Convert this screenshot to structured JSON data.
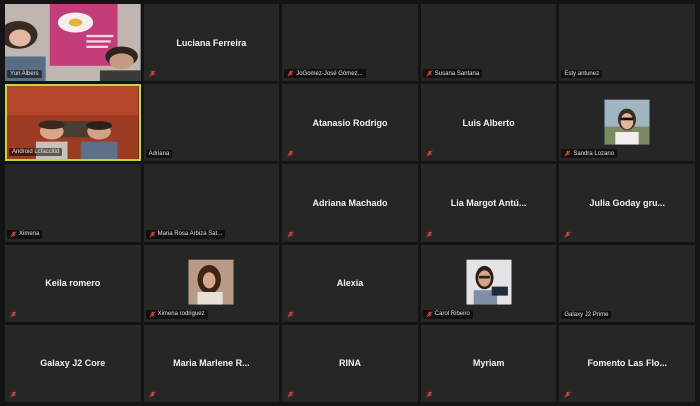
{
  "tiles": [
    {
      "name": "Yuri Albers",
      "display": "video",
      "mic_muted": false
    },
    {
      "name": "Luciana Ferreira",
      "display": "name",
      "mic_muted": true
    },
    {
      "name": "JoGomez-José Gómez...",
      "display": "none",
      "mic_muted": true
    },
    {
      "name": "Susana Santana",
      "display": "none",
      "mic_muted": true
    },
    {
      "name": "Esty antunez",
      "display": "none",
      "mic_muted": false
    },
    {
      "name": "Android Lcfaccitid",
      "display": "video",
      "mic_muted": false,
      "active": true
    },
    {
      "name": "Adriana",
      "display": "none",
      "mic_muted": false
    },
    {
      "name": "Atanasio Rodrigo",
      "display": "name",
      "mic_muted": true
    },
    {
      "name": "Luis Alberto",
      "display": "name",
      "mic_muted": true
    },
    {
      "name": "Sandra Lozano",
      "display": "photo",
      "mic_muted": true
    },
    {
      "name": "Ximena",
      "display": "none",
      "mic_muted": true
    },
    {
      "name": "Maria Rosa Arbiza Sat...",
      "display": "none",
      "mic_muted": true
    },
    {
      "name": "Adriana Machado",
      "display": "name",
      "mic_muted": true
    },
    {
      "name": "Lia Margot Antú...",
      "display": "name",
      "mic_muted": true
    },
    {
      "name": "Julia Goday gru...",
      "display": "name",
      "mic_muted": true
    },
    {
      "name": "Keila romero",
      "display": "name",
      "mic_muted": true
    },
    {
      "name": "Ximena rodriguez",
      "display": "photo",
      "mic_muted": true
    },
    {
      "name": "Alexia",
      "display": "name",
      "mic_muted": true
    },
    {
      "name": "Carol Ribeiro",
      "display": "photo",
      "mic_muted": true
    },
    {
      "name": "Galaxy J2 Prime",
      "display": "none",
      "mic_muted": false
    },
    {
      "name": "Galaxy J2 Core",
      "display": "name",
      "mic_muted": true
    },
    {
      "name": "Maria Marlene R...",
      "display": "name",
      "mic_muted": true
    },
    {
      "name": "RINA",
      "display": "name",
      "mic_muted": true
    },
    {
      "name": "Myriam",
      "display": "name",
      "mic_muted": true
    },
    {
      "name": "Fomento Las Flo...",
      "display": "name",
      "mic_muted": true
    }
  ],
  "colors": {
    "background": "#141414",
    "tile": "#262626",
    "active_border": "#c9d23a",
    "muted_icon": "#e0463c"
  }
}
